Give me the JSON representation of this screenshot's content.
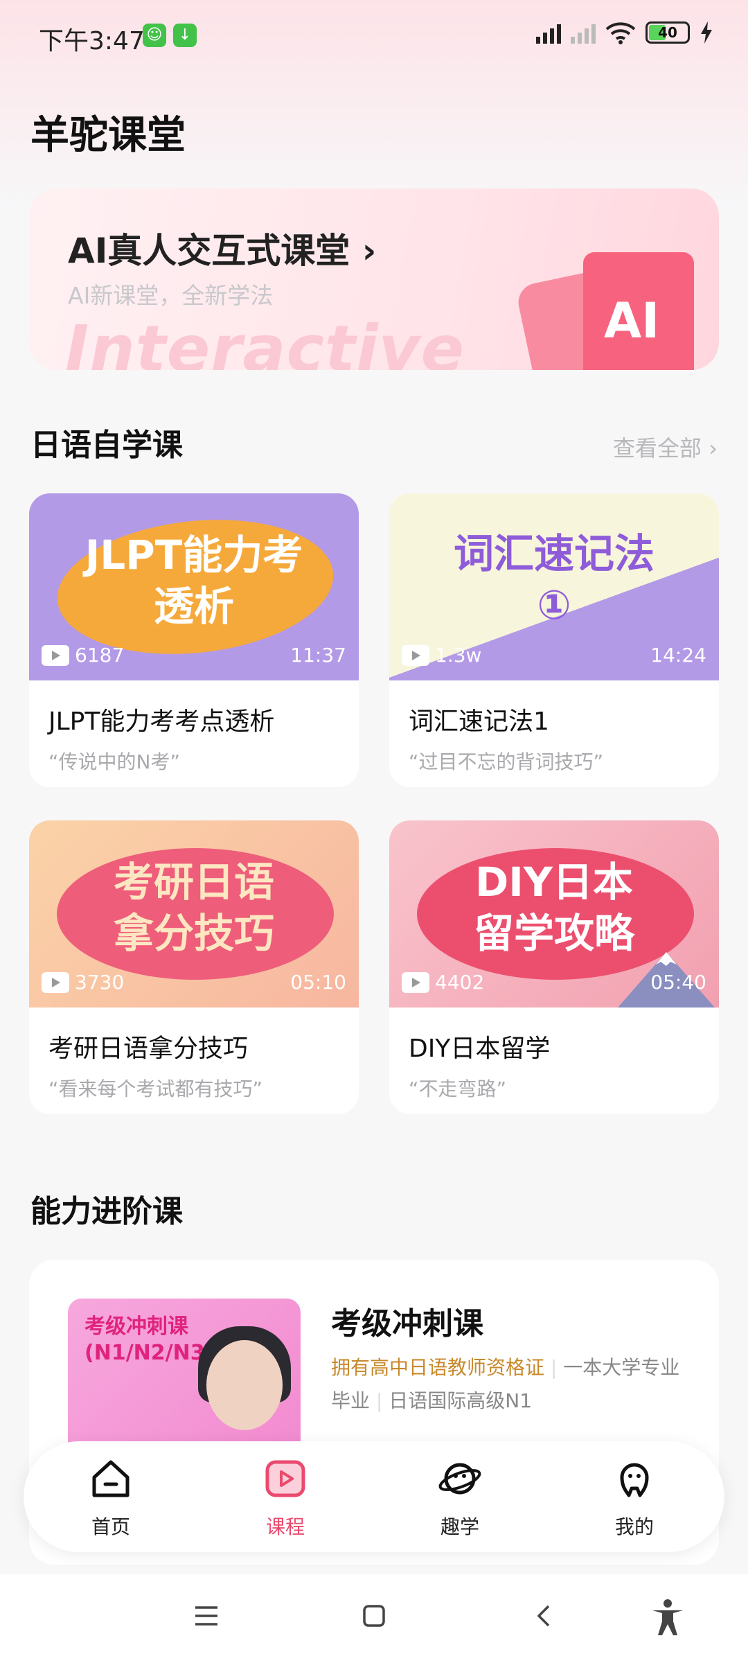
{
  "status_bar": {
    "time": "下午3:47",
    "battery": "40"
  },
  "page_title": "羊驼课堂",
  "banner": {
    "title": "AI真人交互式课堂 ›",
    "subtitle": "AI新课堂，全新学法",
    "watermark": "Interactive",
    "badge": "AI"
  },
  "self_study": {
    "heading": "日语自学课",
    "view_all": "查看全部 ›",
    "courses": [
      {
        "thumb_title": "JLPT能力考\n透析",
        "views": "6187",
        "duration": "11:37",
        "title": "JLPT能力考考点透析",
        "subtitle": "“传说中的N考”"
      },
      {
        "thumb_title": "词汇速记法\n①",
        "views": "1.3w",
        "duration": "14:24",
        "title": "词汇速记法1",
        "subtitle": "“过目不忘的背词技巧”"
      },
      {
        "thumb_title": "考研日语\n拿分技巧",
        "views": "3730",
        "duration": "05:10",
        "title": "考研日语拿分技巧",
        "subtitle": "“看来每个考试都有技巧”"
      },
      {
        "thumb_title": "DIY日本\n留学攻略",
        "views": "4402",
        "duration": "05:40",
        "title": "DIY日本留学",
        "subtitle": "“不走弯路”"
      }
    ]
  },
  "advanced": {
    "heading": "能力进阶课",
    "course": {
      "image_label": "考级冲刺课\n(N1/N2/N3)",
      "title": "考级冲刺课",
      "tag1": "拥有高中日语教师资格证",
      "tag2": "一本大学专业",
      "tag3": "毕业",
      "tag4": "日语国际高级N1"
    }
  },
  "bottom_nav": [
    {
      "label": "首页",
      "icon": "home-icon"
    },
    {
      "label": "课程",
      "icon": "play-icon",
      "active": true
    },
    {
      "label": "趣学",
      "icon": "planet-icon"
    },
    {
      "label": "我的",
      "icon": "profile-icon"
    }
  ],
  "colors": {
    "accent": "#e94a6d",
    "gold": "#c8892b"
  }
}
